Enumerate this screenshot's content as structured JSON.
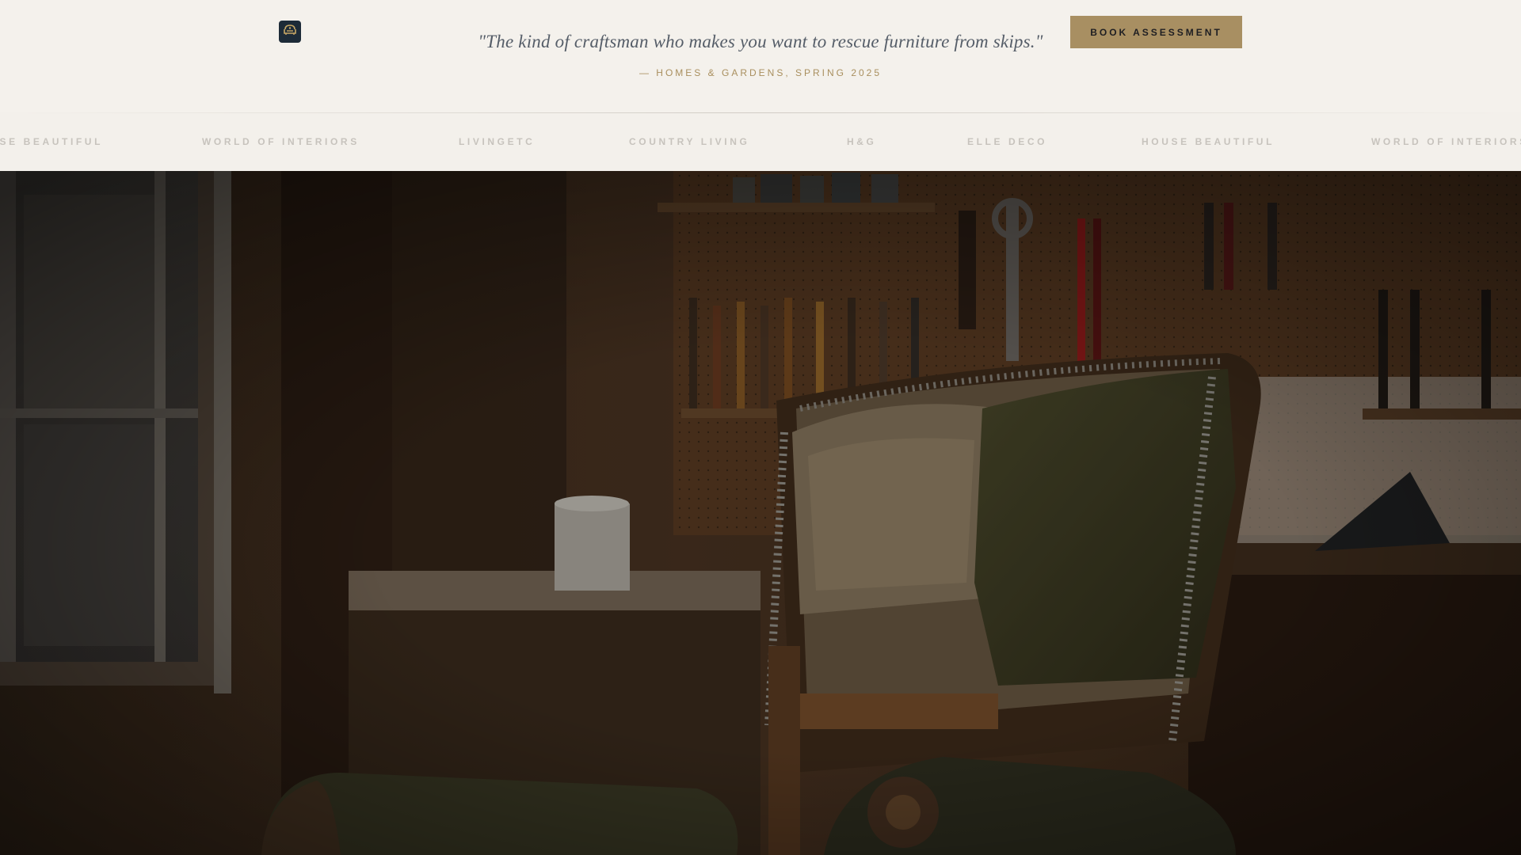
{
  "header": {
    "logo_icon": "armchair-emblem-icon",
    "quote": "\"The kind of craftsman who makes you want to rescue furniture from skips.\"",
    "attribution": "— HOMES & GARDENS, SPRING 2025",
    "book_button_label": "BOOK ASSESSMENT"
  },
  "press_strip": {
    "items": [
      "HOUSE BEAUTIFUL",
      "WORLD OF INTERIORS",
      "LIVINGETC",
      "COUNTRY LIVING",
      "H&G",
      "ELLE DECO",
      "HOUSE BEAUTIFUL",
      "WORLD OF INTERIORS"
    ]
  },
  "hero": {
    "image_subject": "worn-armchair-in-workshop-photo"
  },
  "colors": {
    "background": "#f4f1ec",
    "accent_gold": "#a88f62",
    "navy": "#1d2b38",
    "press_text": "#c7c3bd"
  }
}
